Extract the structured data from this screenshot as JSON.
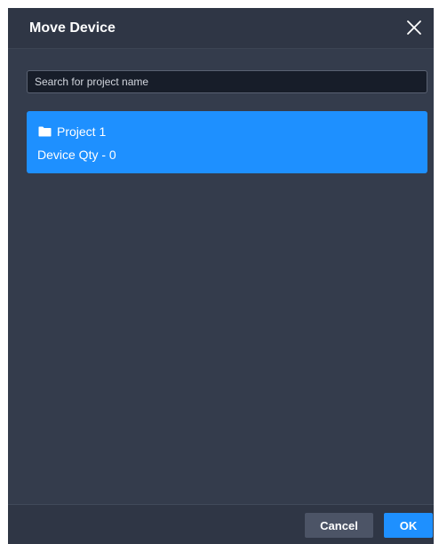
{
  "dialog": {
    "title": "Move Device",
    "close_icon": "close-icon"
  },
  "search": {
    "placeholder": "Search for project name",
    "value": ""
  },
  "projects": [
    {
      "name": "Project 1",
      "device_qty_label": "Device Qty - 0",
      "icon": "folder-icon",
      "selected": true
    }
  ],
  "footer": {
    "cancel_label": "Cancel",
    "ok_label": "OK"
  },
  "colors": {
    "dialog_bg": "#343c4c",
    "header_bg": "#2f3645",
    "accent": "#1e90ff",
    "cancel_bg": "#4c5466",
    "input_bg": "#171d29"
  }
}
